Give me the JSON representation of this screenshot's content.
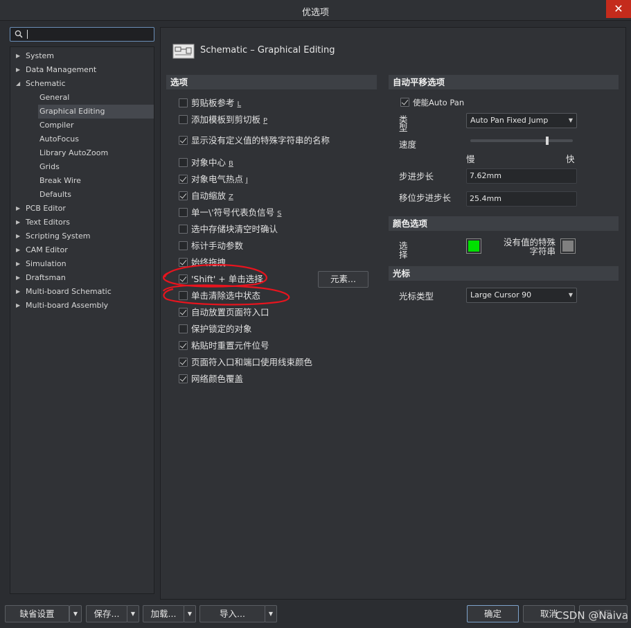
{
  "window": {
    "title": "优选项",
    "close_glyph": "✕"
  },
  "search": {
    "value": "",
    "icon": "search-icon"
  },
  "tree": {
    "items": [
      {
        "label": "System",
        "expanded": false
      },
      {
        "label": "Data Management",
        "expanded": false
      },
      {
        "label": "Schematic",
        "expanded": true
      },
      {
        "label": "PCB Editor",
        "expanded": false
      },
      {
        "label": "Text Editors",
        "expanded": false
      },
      {
        "label": "Scripting System",
        "expanded": false
      },
      {
        "label": "CAM Editor",
        "expanded": false
      },
      {
        "label": "Simulation",
        "expanded": false
      },
      {
        "label": "Draftsman",
        "expanded": false
      },
      {
        "label": "Multi-board Schematic",
        "expanded": false
      },
      {
        "label": "Multi-board Assembly",
        "expanded": false
      }
    ],
    "schematic_children": [
      "General",
      "Graphical Editing",
      "Compiler",
      "AutoFocus",
      "Library AutoZoom",
      "Grids",
      "Break Wire",
      "Defaults"
    ],
    "selected": "Graphical Editing",
    "arrow_collapsed": "▶",
    "arrow_expanded": "◢"
  },
  "page": {
    "title": "Schematic – Graphical Editing"
  },
  "options": {
    "header": "选项",
    "items": [
      {
        "label": "剪贴板参考",
        "key": "L",
        "checked": false
      },
      {
        "label": "添加模板到剪切板",
        "key": "P",
        "checked": false
      },
      {
        "label": "显示没有定义值的特殊字符串的名称",
        "key": "",
        "checked": true
      },
      {
        "label": "对象中心",
        "key": "B",
        "checked": false
      },
      {
        "label": "对象电气热点",
        "key": "J",
        "checked": true
      },
      {
        "label": "自动缩放",
        "key": "Z",
        "checked": true
      },
      {
        "label": "单一\\'符号代表负信号",
        "key": "S",
        "checked": false
      },
      {
        "label": "选中存储块清空时确认",
        "key": "",
        "checked": false
      },
      {
        "label": "标计手动参数",
        "key": "",
        "checked": false
      },
      {
        "label": "始终拖拽",
        "key": "",
        "checked": true
      },
      {
        "label": "'Shift' + 单击选择",
        "key": "",
        "checked": true
      },
      {
        "label": "单击清除选中状态",
        "key": "",
        "checked": false
      },
      {
        "label": "自动放置页面符入口",
        "key": "",
        "checked": true
      },
      {
        "label": "保护锁定的对象",
        "key": "",
        "checked": false
      },
      {
        "label": "粘贴时重置元件位号",
        "key": "",
        "checked": true
      },
      {
        "label": "页面符入口和端口使用线束颜色",
        "key": "",
        "checked": true
      },
      {
        "label": "网络颜色覆盖",
        "key": "",
        "checked": true
      }
    ],
    "elements_button": "元素..."
  },
  "autopan": {
    "header": "自动平移选项",
    "enable_label": "使能Auto Pan",
    "enable_checked": true,
    "type_label": "类\n型",
    "type_value": "Auto Pan Fixed Jump",
    "speed_label": "速度",
    "speed_level": 0.75,
    "slow_label": "慢",
    "fast_label": "快",
    "step_label": "步进步长",
    "step_value": "7.62mm",
    "shift_step_label": "移位步进步长",
    "shift_step_value": "25.4mm"
  },
  "colors": {
    "header": "颜色选项",
    "selection_label": "选\n择",
    "selection_color": "#00e000",
    "no_value_label": "没有值的特殊\n字符串",
    "no_value_color": "#808080"
  },
  "cursor": {
    "header": "光标",
    "type_label": "光标类型",
    "type_value": "Large Cursor 90"
  },
  "footer": {
    "defaults": "缺省设置",
    "save": "保存...",
    "load": "加载...",
    "import": "导入...",
    "ok": "确定",
    "cancel": "取消",
    "apply": "应用",
    "dropdown_arrow": "▼",
    "watermark": "CSDN @Naiva"
  },
  "annotation_color": "#e8141e"
}
